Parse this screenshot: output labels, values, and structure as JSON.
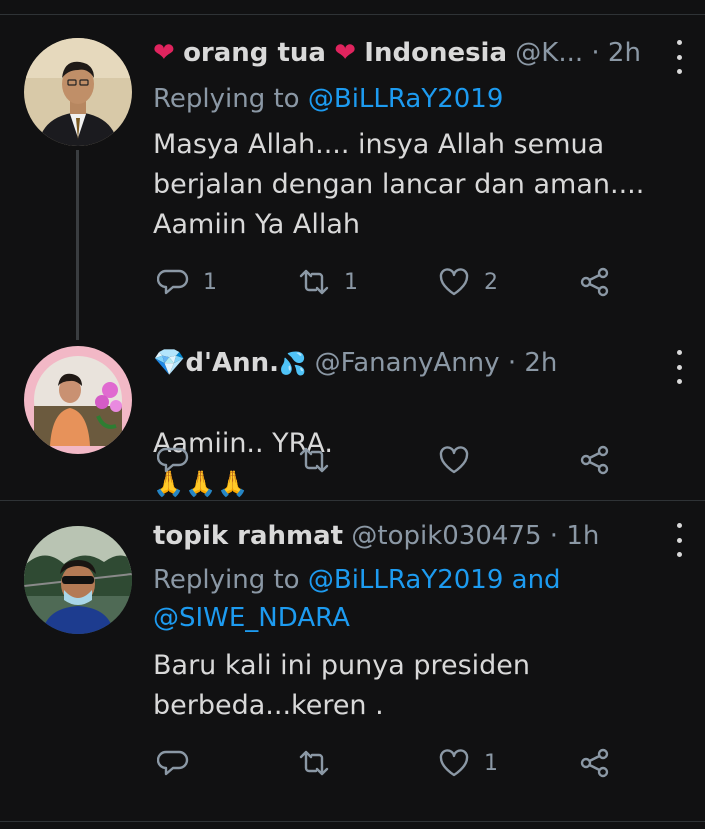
{
  "tweets": [
    {
      "name": "orang tua",
      "name_suffix": "Indonesia",
      "handle": "@K...",
      "time": "2h",
      "reply_prefix": "Replying to",
      "reply_mentions": "@BiLLRaY2019",
      "text": "Masya Allah.... insya Allah semua\nberjalan dengan lancar dan aman....\nAamiin Ya Allah",
      "replies": "1",
      "retweets": "1",
      "likes": "2"
    },
    {
      "name": "d'Ann.",
      "handle": "@FananyAnny",
      "time": "2h",
      "text": "Aamiin..  YRA.",
      "emoji": "🙏🙏🙏"
    },
    {
      "name": "topik rahmat",
      "handle": "@topik030475",
      "time": "1h",
      "reply_prefix": "Replying to",
      "reply_mention_1": "@BiLLRaY2019",
      "reply_and": "and",
      "reply_mention_2": "@SIWE_NDARA",
      "text": "Baru kali ini punya presiden\nberbeda...keren .",
      "likes": "1"
    }
  ],
  "symbols": {
    "dot": "·",
    "heart": "❤",
    "gem": "💎",
    "drops": "💦"
  },
  "colors": {
    "background": "#111112",
    "link": "#1d9bf0",
    "muted": "#8b98a5",
    "heart": "#e0245e"
  }
}
